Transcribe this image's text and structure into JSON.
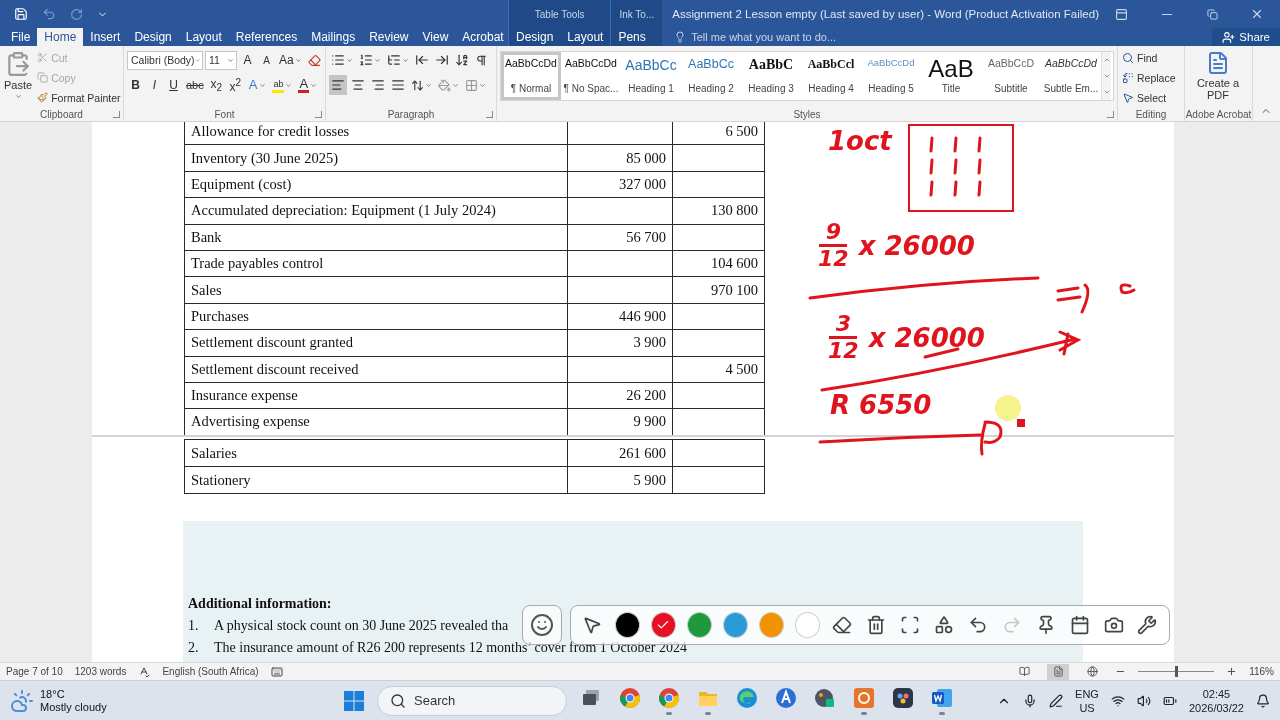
{
  "title_bar": {
    "title": "Assignment 2 Lesson empty (Last saved by user) - Word (Product Activation Failed)",
    "redo_disabled": true
  },
  "tabs": [
    {
      "label": "File",
      "selected": false
    },
    {
      "label": "Home",
      "selected": true
    },
    {
      "label": "Insert",
      "selected": false
    },
    {
      "label": "Design",
      "selected": false
    },
    {
      "label": "Layout",
      "selected": false
    },
    {
      "label": "References",
      "selected": false
    },
    {
      "label": "Mailings",
      "selected": false
    },
    {
      "label": "Review",
      "selected": false
    },
    {
      "label": "View",
      "selected": false
    },
    {
      "label": "Acrobat",
      "selected": false
    }
  ],
  "context_groups": [
    {
      "title": "Table Tools",
      "tabs": [
        {
          "label": "Design",
          "selected": false
        },
        {
          "label": "Layout",
          "selected": false
        }
      ]
    },
    {
      "title": "Ink To...",
      "tabs": [
        {
          "label": "Pens",
          "selected": false
        }
      ]
    }
  ],
  "tell_me": {
    "placeholder": "Tell me what you want to do..."
  },
  "share": "Share",
  "ribbon": {
    "clipboard": {
      "label": "Clipboard",
      "paste": "Paste",
      "items": [
        {
          "label": "Cut",
          "kind": "cut",
          "disabled": true
        },
        {
          "label": "Copy",
          "kind": "copy",
          "disabled": true
        },
        {
          "label": "Format Painter",
          "kind": "painter",
          "disabled": false
        }
      ]
    },
    "font": {
      "label": "Font",
      "font_name": "Calibri (Body)",
      "font_size": "11",
      "grow": "A",
      "shrink": "A",
      "change_case": "Aa",
      "format_buttons": [
        {
          "text": "B",
          "kind": "bold"
        },
        {
          "text": "I",
          "kind": "italic"
        },
        {
          "text": "U",
          "kind": "underline"
        },
        {
          "text": "abc",
          "kind": "strike"
        },
        {
          "text": "x$_{2}$",
          "kind": "script"
        },
        {
          "text": "x$^{2}$",
          "kind": "script"
        }
      ],
      "color_buttons": [
        {
          "text": "A",
          "kind": "effects"
        },
        {
          "text": "ab",
          "kind": "highlight"
        },
        {
          "text": "A",
          "kind": "font_color"
        }
      ]
    },
    "paragraph": {
      "label": "Paragraph",
      "alignments": [
        {
          "kind": "left",
          "selected": true
        },
        {
          "kind": "center",
          "selected": false
        },
        {
          "kind": "right",
          "selected": false
        },
        {
          "kind": "justify",
          "selected": false
        }
      ]
    },
    "styles": {
      "label": "Styles",
      "items": [
        {
          "preview": "AaBbCcDd",
          "name": "¶ Normal",
          "kind": "normal",
          "selected": true
        },
        {
          "preview": "AaBbCcDd",
          "name": "¶ No Spac...",
          "kind": "normal",
          "selected": false
        },
        {
          "preview": "AaBbCc",
          "name": "Heading 1",
          "kind": "heading1",
          "selected": false
        },
        {
          "preview": "AaBbCc",
          "name": "Heading 2",
          "kind": "heading2",
          "selected": false
        },
        {
          "preview": "AaBbC",
          "name": "Heading 3",
          "kind": "heading3",
          "selected": false
        },
        {
          "preview": "AaBbCcl",
          "name": "Heading 4",
          "kind": "heading4",
          "selected": false
        },
        {
          "preview": "AaBbCcDd",
          "name": "Heading 5",
          "kind": "heading5",
          "selected": false
        },
        {
          "preview": "AaB",
          "name": "Title",
          "kind": "title",
          "selected": false
        },
        {
          "preview": "AaBbCcD",
          "name": "Subtitle",
          "kind": "subtitle",
          "selected": false
        },
        {
          "preview": "AaBbCcDd",
          "name": "Subtle Em...",
          "kind": "emphasis",
          "selected": false
        }
      ]
    },
    "editing": {
      "label": "Editing",
      "items": [
        {
          "label": "Find",
          "kind": "find"
        },
        {
          "label": "Replace",
          "kind": "replace"
        },
        {
          "label": "Select",
          "kind": "select"
        }
      ]
    },
    "acrobat": {
      "label": "Adobe Acrobat",
      "button": "Create a PDF"
    }
  },
  "document": {
    "table_rows": [
      {
        "account": "Allowance for credit losses",
        "credit": "6 500"
      },
      {
        "account": "Inventory (30 June 2025)",
        "debit": "85 000"
      },
      {
        "account": "Equipment (cost)",
        "debit": "327 000"
      },
      {
        "account": "Accumulated depreciation: Equipment (1 July 2024)",
        "credit": "130 800"
      },
      {
        "account": "Bank",
        "debit": "56 700"
      },
      {
        "account": "Trade payables control",
        "credit": "104 600"
      },
      {
        "account": "Sales",
        "credit": "970 100"
      },
      {
        "account": "Purchases",
        "debit": "446 900"
      },
      {
        "account": "Settlement discount granted",
        "debit": "3 900"
      },
      {
        "account": "Settlement discount received",
        "credit": "4 500"
      },
      {
        "account": "Insurance expense",
        "debit": "26 200"
      },
      {
        "account": "Advertising expense",
        "debit": "9 900"
      }
    ],
    "next_page_rows": [
      {
        "account": "Salaries",
        "debit": "261 600"
      },
      {
        "account": "Stationery",
        "debit": "5 900"
      }
    ],
    "heading": "Additional information:",
    "list": [
      {
        "number": "1.",
        "text": "A physical stock count on 30 June 2025 revealed tha"
      },
      {
        "number": "2.",
        "text": "The insurance amount of R26 200 represents 12 months’ cover from 1 October 2024"
      }
    ]
  },
  "ink": {
    "notes": [
      {
        "kind": "text",
        "text": "1oct"
      },
      {
        "kind": "fraction",
        "numerator": "9",
        "denominator": "12",
        "rest": "x 26000"
      },
      {
        "kind": "fraction",
        "numerator": "3",
        "denominator": "12",
        "rest": "x 26000"
      },
      {
        "kind": "text",
        "text": "R 6550"
      }
    ]
  },
  "pen_toolbar": {
    "redo_disabled": true,
    "colors": [
      {
        "color": "#000000",
        "selected": false
      },
      {
        "color": "#e81123",
        "selected": true
      },
      {
        "color": "#1e9a3c",
        "selected": false
      },
      {
        "color": "#2b9bd8",
        "selected": false
      },
      {
        "color": "#f39200",
        "selected": false
      },
      {
        "color": "#ffffff",
        "selected": false
      }
    ]
  },
  "status_bar": {
    "page": "Page 7 of 10",
    "words": "1203 words",
    "language": "English (South Africa)",
    "zoom": "116%",
    "zoom_level": {
      "level": 0.5
    },
    "views": [
      {
        "kind": "read",
        "selected": false
      },
      {
        "kind": "print",
        "selected": true
      },
      {
        "kind": "web",
        "selected": false
      }
    ]
  },
  "taskbar": {
    "weather": {
      "temperature": "18°C",
      "condition": "Mostly cloudy"
    },
    "search": {
      "placeholder": "Search"
    },
    "apps": [
      {
        "kind": "taskview",
        "running": false
      },
      {
        "kind": "chrome",
        "running": false
      },
      {
        "kind": "chrome",
        "running": true
      },
      {
        "kind": "folder",
        "running": true
      },
      {
        "kind": "edge",
        "running": false
      },
      {
        "kind": "store",
        "running": false
      },
      {
        "kind": "paint",
        "running": false
      },
      {
        "kind": "orange",
        "running": true
      },
      {
        "kind": "resolve",
        "running": false
      },
      {
        "kind": "word",
        "running": true
      }
    ],
    "tray": {
      "language": "ENG",
      "region": "US",
      "time": "02:45",
      "date": "2026/03/22"
    }
  }
}
